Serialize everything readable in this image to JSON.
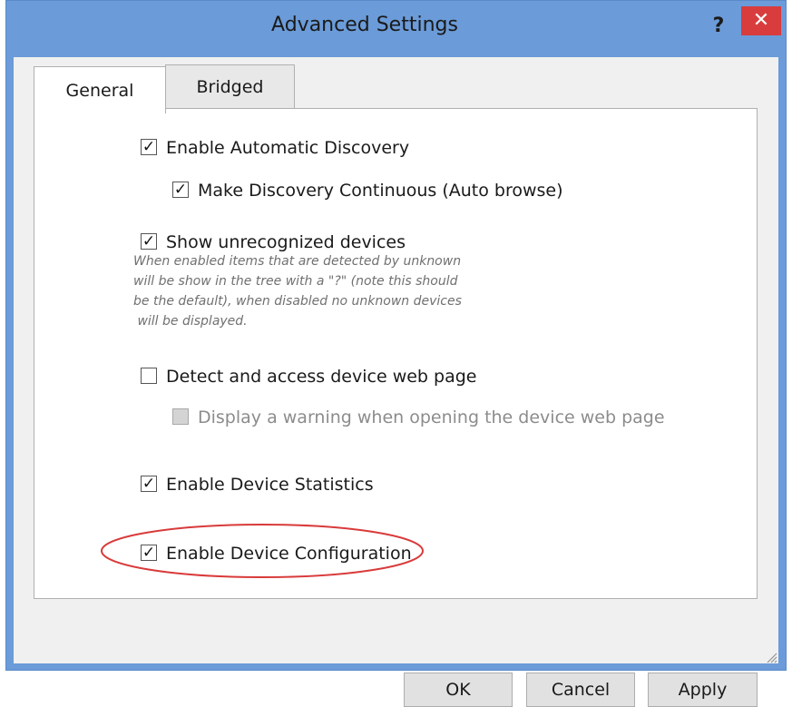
{
  "window": {
    "title": "Advanced Settings",
    "help_glyph": "?",
    "close_glyph": "✕"
  },
  "tabs": [
    {
      "label": "General",
      "selected": true
    },
    {
      "label": "Bridged",
      "selected": false
    }
  ],
  "options": {
    "auto_discovery": {
      "label": "Enable Automatic Discovery",
      "checked": true
    },
    "continuous": {
      "label": "Make Discovery Continuous (Auto browse)",
      "checked": true
    },
    "unrecognized": {
      "label": "Show unrecognized devices",
      "checked": true,
      "description": "When enabled items that are detected by unknown\nwill be show in the tree with a \"?\" (note this should\nbe the default), when disabled no unknown devices\n will be displayed."
    },
    "web_page": {
      "label": "Detect and access device web page",
      "checked": false
    },
    "web_warning": {
      "label": "Display a warning when opening the device web page",
      "checked": false,
      "disabled": true
    },
    "statistics": {
      "label": "Enable Device Statistics",
      "checked": true
    },
    "configuration": {
      "label": "Enable Device Configuration",
      "checked": true
    }
  },
  "buttons": {
    "ok": "OK",
    "cancel": "Cancel",
    "apply": "Apply"
  },
  "colors": {
    "title_bar": "#6b9bd8",
    "close_button": "#d83c3c",
    "highlight_ellipse": "#d93a3a"
  }
}
